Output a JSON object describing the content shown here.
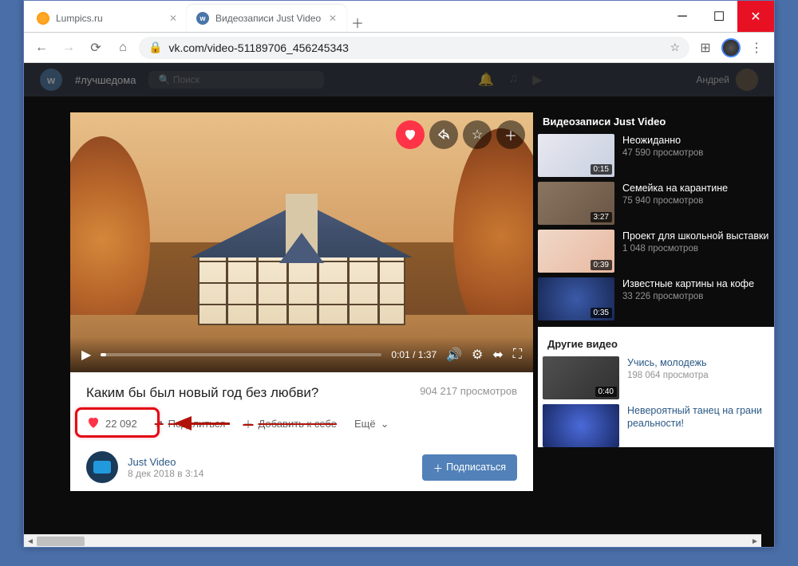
{
  "browser": {
    "tabs": [
      {
        "title": "Lumpics.ru",
        "active": false
      },
      {
        "title": "Видеозаписи Just Video",
        "active": true
      }
    ],
    "url": "vk.com/video-51189706_456245343"
  },
  "vk_header": {
    "hashtag": "#лучшедома",
    "search_placeholder": "Поиск",
    "username": "Андрей"
  },
  "video": {
    "title": "Каким бы был новый год без любви?",
    "views": "904 217 просмотров",
    "time_current": "0:01",
    "time_total": "1:37",
    "likes": "22 092",
    "share_label": "Поделиться",
    "add_label": "Добавить к себе",
    "more_label": "Ещё",
    "author": "Just Video",
    "date": "8 дек 2018 в 3:14",
    "subscribe_label": "Подписаться"
  },
  "sidebar": {
    "heading": "Видеозаписи Just Video",
    "items": [
      {
        "title": "Неожиданно",
        "views": "47 590 просмотров",
        "dur": "0:15"
      },
      {
        "title": "Семейка на карантине",
        "views": "75 940 просмотров",
        "dur": "3:27"
      },
      {
        "title": "Проект для школьной выставки",
        "views": "1 048 просмотров",
        "dur": "0:39"
      },
      {
        "title": "Известные картины на кофе",
        "views": "33 226 просмотров",
        "dur": "0:35"
      }
    ],
    "other_heading": "Другие видео",
    "other": [
      {
        "title": "Учись, молодежь",
        "views": "198 064 просмотра",
        "dur": "0:40"
      },
      {
        "title": "Невероятный танец на грани реальности!",
        "views": "",
        "dur": ""
      }
    ]
  }
}
